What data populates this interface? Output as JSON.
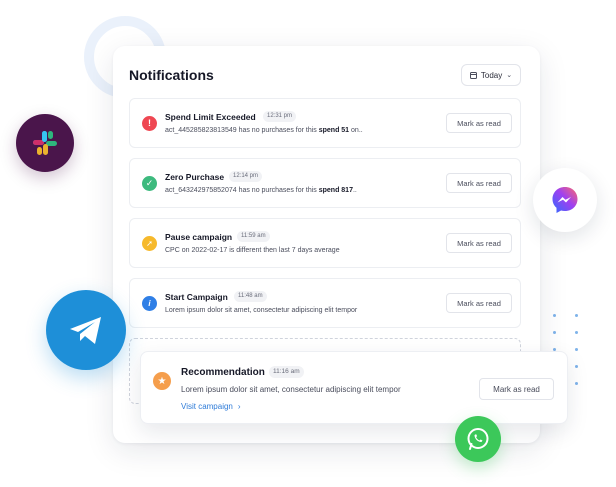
{
  "panel": {
    "title": "Notifications",
    "date_filter": "Today"
  },
  "notifications": [
    {
      "title": "Spend Limit Exceeded",
      "time": "12:31 pm",
      "desc_prefix": "act_445285823813549 has no purchases for this ",
      "desc_bold": "spend 51",
      "desc_suffix": " on..",
      "action": "Mark as read",
      "status": "error",
      "icon": "exclamation-icon",
      "color": "#ef4752"
    },
    {
      "title": "Zero Purchase",
      "time": "12:14 pm",
      "desc_prefix": "act_643242975852074 has no purchases for this ",
      "desc_bold": "spend 817",
      "desc_suffix": "..",
      "action": "Mark as read",
      "status": "success",
      "icon": "check-icon",
      "color": "#3dba7e"
    },
    {
      "title": "Pause campaign",
      "time": "11:59 am",
      "desc_prefix": "CPC on 2022-02-17 is different then last 7 days average",
      "desc_bold": "",
      "desc_suffix": "",
      "action": "Mark as read",
      "status": "warning",
      "icon": "pin-icon",
      "color": "#f6b92c"
    },
    {
      "title": "Start Campaign",
      "time": "11:48 am",
      "desc_prefix": "Lorem ipsum dolor sit amet, consectetur adipiscing elit tempor",
      "desc_bold": "",
      "desc_suffix": "",
      "action": "Mark as read",
      "status": "info",
      "icon": "info-icon",
      "color": "#2f7fe6"
    }
  ],
  "recommendation": {
    "title": "Recommendation",
    "time": "11:16 am",
    "desc": "Lorem ipsum dolor sit amet, consectetur adipiscing elit tempor",
    "link": "Visit campaign",
    "action": "Mark as read",
    "icon": "star-icon",
    "color": "#f59e4c"
  },
  "apps": [
    {
      "name": "slack-icon",
      "color": "#4a154b"
    },
    {
      "name": "messenger-icon",
      "color": "#a040f0"
    },
    {
      "name": "telegram-icon",
      "color": "#1e8fd8"
    },
    {
      "name": "whatsapp-icon",
      "color": "#3cc85a"
    }
  ]
}
